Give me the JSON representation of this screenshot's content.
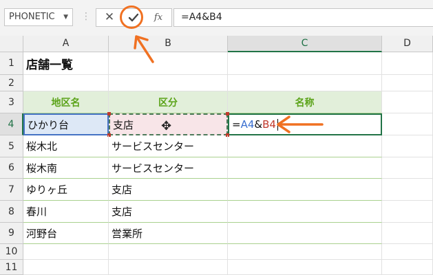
{
  "formula_bar": {
    "name_box": "PHONETIC",
    "cancel_glyph": "✕",
    "enter_glyph": "✓",
    "fx_label": "fx",
    "formula": "=A4&B4"
  },
  "columns": [
    "A",
    "B",
    "C",
    "D"
  ],
  "rows": [
    "1",
    "2",
    "3",
    "4",
    "5",
    "6",
    "7",
    "8",
    "9",
    "10",
    "11"
  ],
  "cells": {
    "A1": "店舗一覧",
    "A3": "地区名",
    "B3": "区分",
    "C3": "名称",
    "A4": "ひかり台",
    "B4": "支店",
    "C4": {
      "eq": "=",
      "ref_a": "A4",
      "amp": "&",
      "ref_b": "B4"
    },
    "A5": "桜木北",
    "B5": "サービスセンター",
    "A6": "桜木南",
    "B6": "サービスセンター",
    "A7": "ゆりヶ丘",
    "B7": "支店",
    "A8": "春川",
    "B8": "支店",
    "A9": "河野台",
    "B9": "営業所"
  },
  "colors": {
    "accent_annotation": "#f07122",
    "header_fill": "#e2efda",
    "header_text": "#5ba319",
    "ref_a": "#3a6fd0",
    "ref_b": "#c0392b",
    "selection": "#217346"
  }
}
